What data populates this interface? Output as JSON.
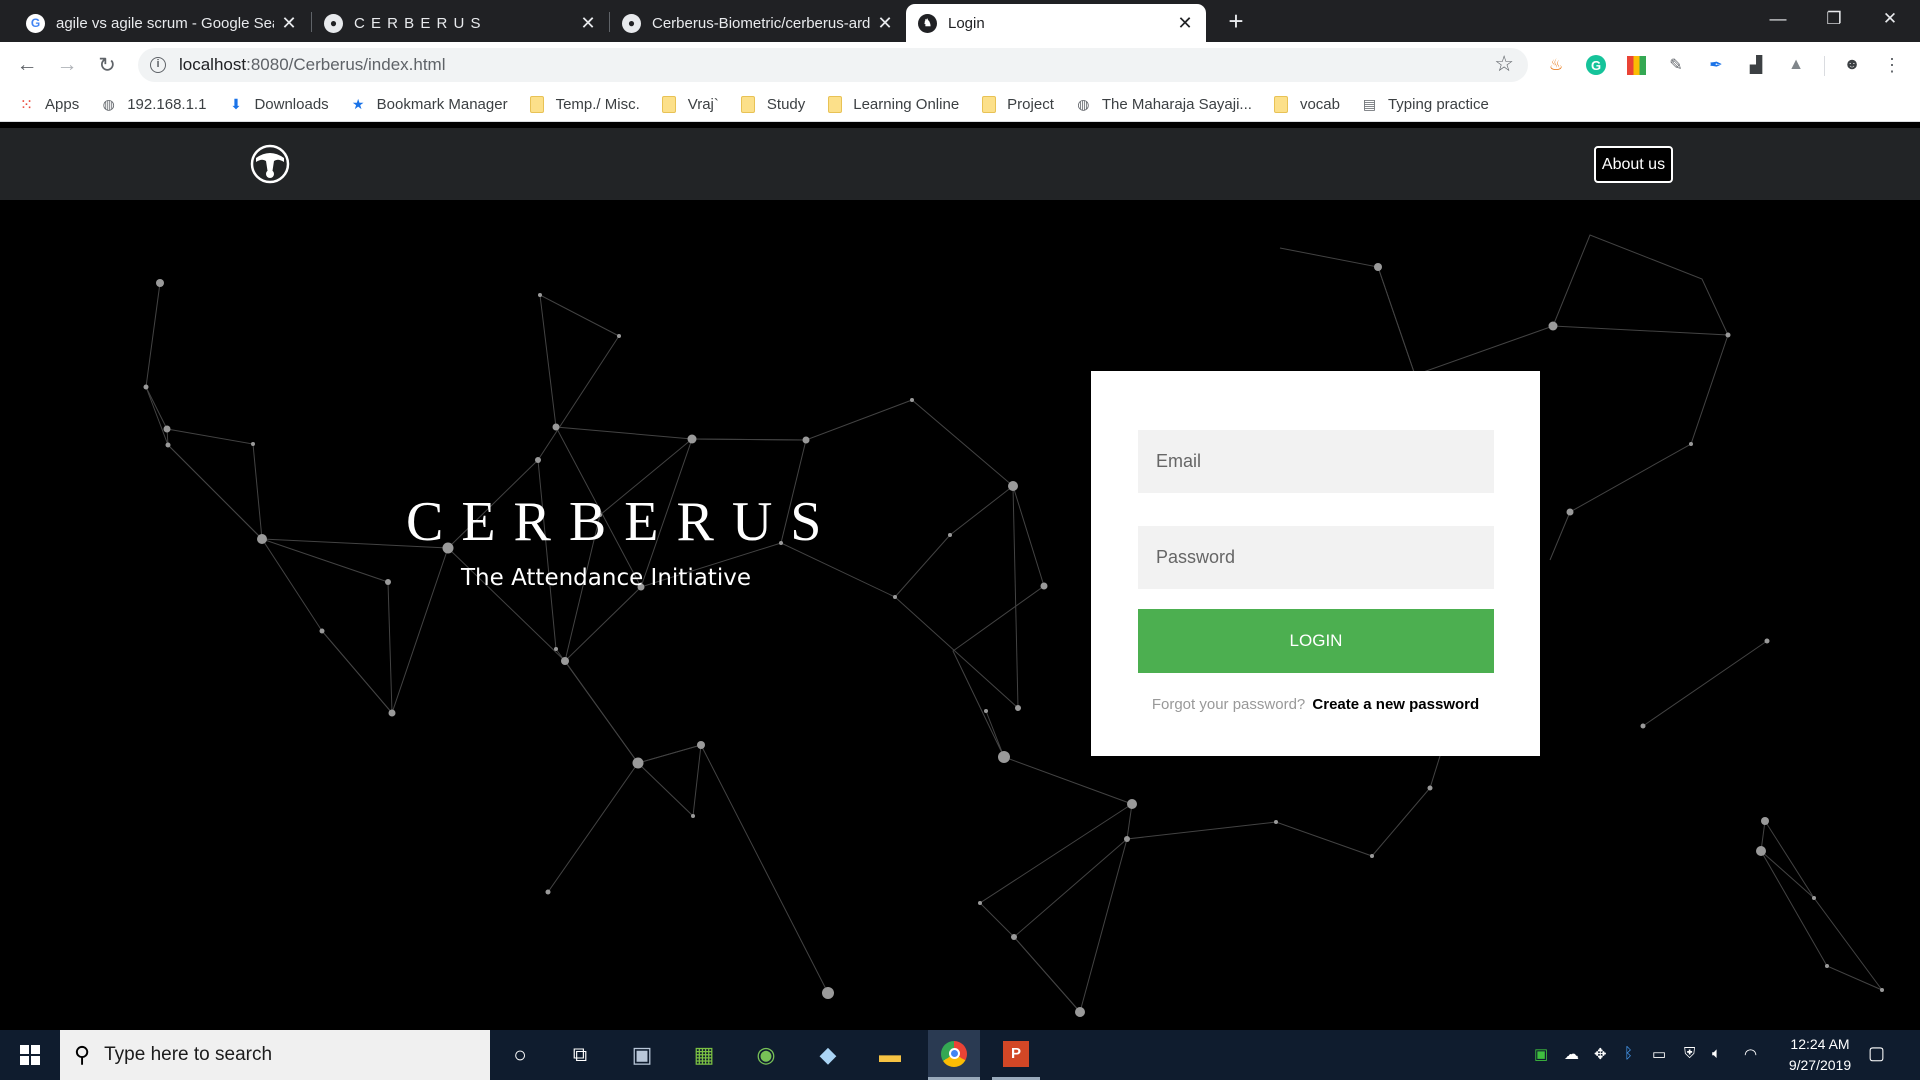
{
  "browser": {
    "tabs": [
      {
        "title": "agile vs agile scrum - Google Sea",
        "icon": "google-g",
        "active": false
      },
      {
        "title": "C E R B E R U S",
        "icon": "github",
        "active": false
      },
      {
        "title": "Cerberus-Biometric/cerberus-ard",
        "icon": "github",
        "active": false
      },
      {
        "title": "Login",
        "icon": "cerberus-logo",
        "active": true
      }
    ],
    "url": {
      "host": "localhost",
      "path": ":8080/Cerberus/index.html"
    },
    "bookmarks": [
      {
        "label": "Apps",
        "icon": "apps-grid"
      },
      {
        "label": "192.168.1.1",
        "icon": "globe"
      },
      {
        "label": "Downloads",
        "icon": "download-arrow"
      },
      {
        "label": "Bookmark Manager",
        "icon": "star"
      },
      {
        "label": "Temp./ Misc.",
        "icon": "folder"
      },
      {
        "label": "Vraj`",
        "icon": "folder"
      },
      {
        "label": "Study",
        "icon": "folder"
      },
      {
        "label": "Learning Online",
        "icon": "folder"
      },
      {
        "label": "Project",
        "icon": "folder"
      },
      {
        "label": "The Maharaja Sayaji...",
        "icon": "globe"
      },
      {
        "label": "vocab",
        "icon": "folder"
      },
      {
        "label": "Typing practice",
        "icon": "page"
      }
    ]
  },
  "page": {
    "nav": {
      "about_label": "About us"
    },
    "hero": {
      "title": "CERBERUS",
      "subtitle": "The Attendance Initiative"
    },
    "login": {
      "email_placeholder": "Email",
      "password_placeholder": "Password",
      "button_label": "LOGIN",
      "forgot_text": "Forgot your password?",
      "create_link": "Create a new password"
    }
  },
  "taskbar": {
    "search_placeholder": "Type here to search",
    "time": "12:24 AM",
    "date": "9/27/2019"
  },
  "colors": {
    "accent": "#4caf50",
    "nav_bg": "#222426",
    "taskbar_bg": "#0f1c2e"
  }
}
